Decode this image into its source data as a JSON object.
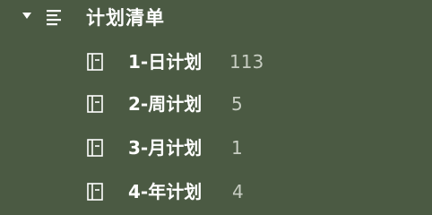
{
  "group": {
    "title": "计划清单",
    "chevron_icon": "triangle-down-icon",
    "list_icon": "list-lines-icon"
  },
  "items": [
    {
      "label": "1-日计划",
      "count": "113",
      "icon": "notebook-icon"
    },
    {
      "label": "2-周计划",
      "count": "5",
      "icon": "notebook-icon"
    },
    {
      "label": "3-月计划",
      "count": "1",
      "icon": "notebook-icon"
    },
    {
      "label": "4-年计划",
      "count": "4",
      "icon": "notebook-icon"
    }
  ],
  "colors": {
    "background": "#4b5a43",
    "text": "#ffffff",
    "count_text": "#c7cdc2"
  }
}
